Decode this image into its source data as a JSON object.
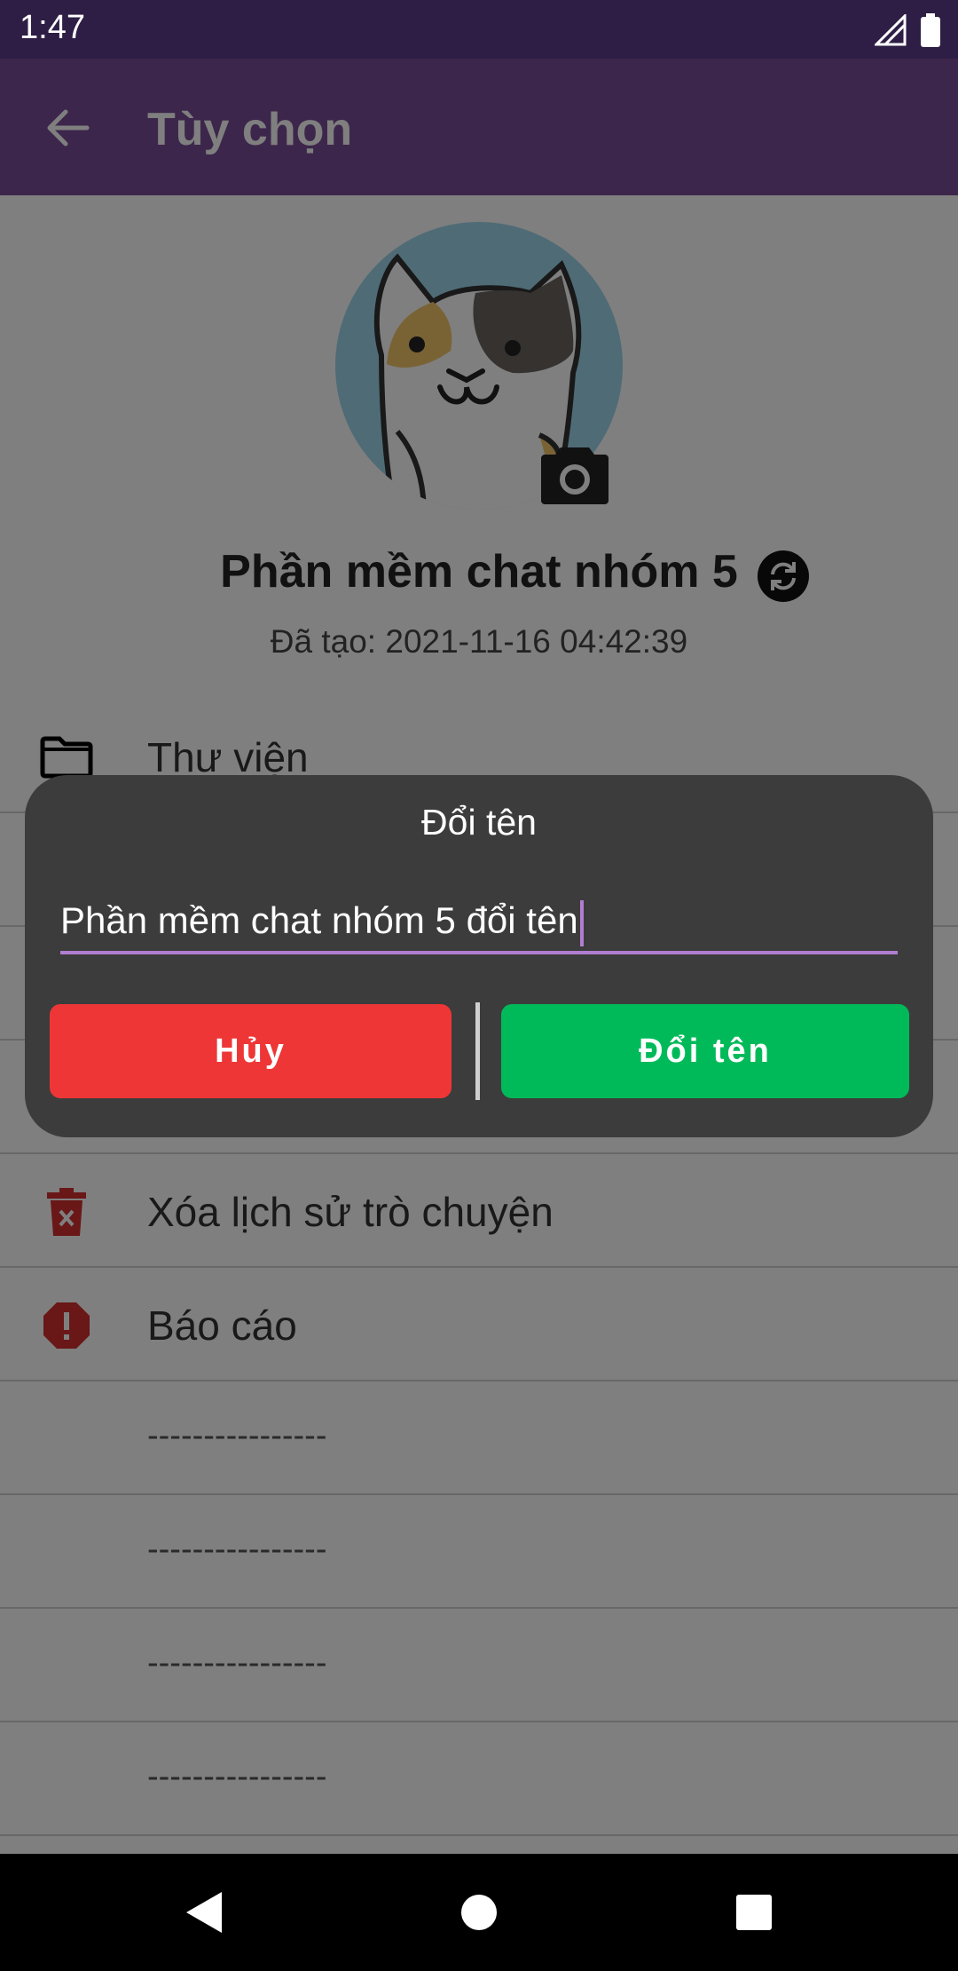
{
  "status_bar": {
    "time": "1:47"
  },
  "app_bar": {
    "title": "Tùy chọn"
  },
  "profile": {
    "group_name": "Phần mềm chat nhóm 5",
    "created": "Đã tạo: 2021-11-16 04:42:39"
  },
  "menu": {
    "items": [
      {
        "label": "Thư viện",
        "icon": "folder-icon"
      },
      {
        "label": "",
        "icon": ""
      },
      {
        "label": "",
        "icon": ""
      },
      {
        "label": "",
        "icon": ""
      },
      {
        "label": "Xóa lịch sử trò chuyện",
        "icon": "trash-icon"
      },
      {
        "label": "Báo cáo",
        "icon": "alert-icon"
      },
      {
        "label": "----------------",
        "icon": ""
      },
      {
        "label": "----------------",
        "icon": ""
      },
      {
        "label": "----------------",
        "icon": ""
      },
      {
        "label": "----------------",
        "icon": ""
      }
    ]
  },
  "dialog": {
    "title": "Đổi tên",
    "input_value": "Phần mềm chat nhóm 5 đổi tên",
    "cancel_label": "Hủy",
    "confirm_label": "Đổi tên"
  },
  "colors": {
    "app_bar": "#7b4d96",
    "status_bar": "#2e1e46",
    "cancel": "#ee3636",
    "confirm": "#00ba5a",
    "accent": "#b07ed0"
  }
}
